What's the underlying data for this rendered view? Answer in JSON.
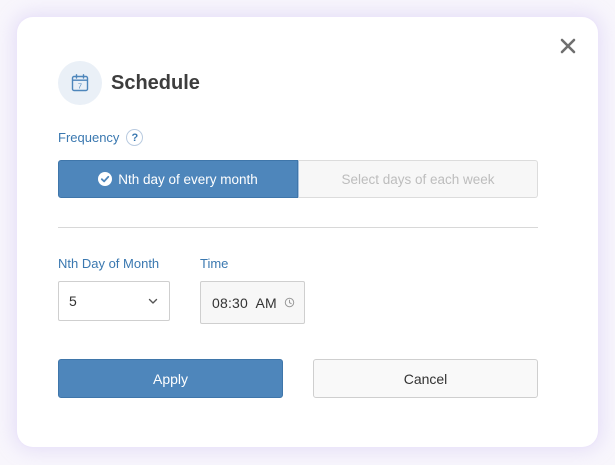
{
  "dialog": {
    "title": "Schedule",
    "title_icon": "calendar-icon",
    "calendar_day": "7",
    "close_icon": "close-icon"
  },
  "frequency": {
    "label": "Frequency",
    "help_glyph": "?",
    "options": [
      {
        "label": "Nth day of every month",
        "selected": true
      },
      {
        "label": "Select days of each week",
        "selected": false
      }
    ]
  },
  "nth_day": {
    "label": "Nth Day of Month",
    "value": "5",
    "icon": "chevron-down-icon"
  },
  "time": {
    "label": "Time",
    "value": "08:30  AM",
    "icon": "clock-icon"
  },
  "actions": {
    "apply_label": "Apply",
    "cancel_label": "Cancel"
  },
  "colors": {
    "accent": "#4e86bb",
    "label": "#3a78b0",
    "title": "#3d3d3d"
  }
}
